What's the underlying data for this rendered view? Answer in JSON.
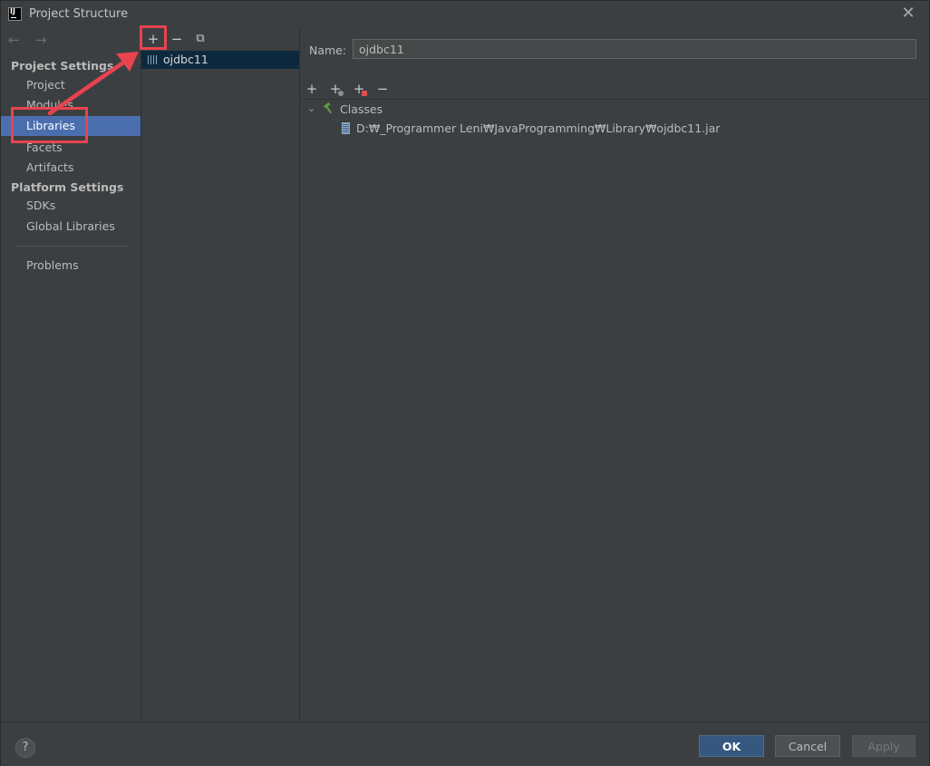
{
  "window": {
    "title": "Project Structure",
    "close_glyph": "✕"
  },
  "nav": {
    "back_glyph": "←",
    "forward_glyph": "→",
    "project_settings_header": "Project Settings",
    "platform_settings_header": "Platform Settings",
    "items": [
      {
        "label": "Project"
      },
      {
        "label": "Modules"
      },
      {
        "label": "Libraries",
        "selected": true
      },
      {
        "label": "Facets"
      },
      {
        "label": "Artifacts"
      },
      {
        "label": "SDKs"
      },
      {
        "label": "Global Libraries"
      },
      {
        "label": "Problems"
      }
    ]
  },
  "library_list": {
    "add_glyph": "+",
    "remove_glyph": "−",
    "copy_glyph": "⧉",
    "items": [
      {
        "label": "ojdbc11",
        "selected": true
      }
    ]
  },
  "detail": {
    "name_label": "Name:",
    "name_value": "ojdbc11",
    "toolbar": {
      "add_glyph": "+",
      "add_alt_glyph": "+",
      "add_excluded_glyph": "+",
      "remove_glyph": "−"
    },
    "tree": {
      "chevron_glyph": "⌄",
      "classes_label": "Classes",
      "jar_path": "D:₩_Programmer Leni₩JavaProgramming₩Library₩ojdbc11.jar"
    }
  },
  "footer": {
    "help_label": "?",
    "ok_label": "OK",
    "cancel_label": "Cancel",
    "apply_label": "Apply"
  },
  "colors": {
    "background": "#3c3f41",
    "selection": "#4b6eaf",
    "list_selection": "#0d293e",
    "annotation": "#e8434f",
    "ok_button": "#365880"
  }
}
